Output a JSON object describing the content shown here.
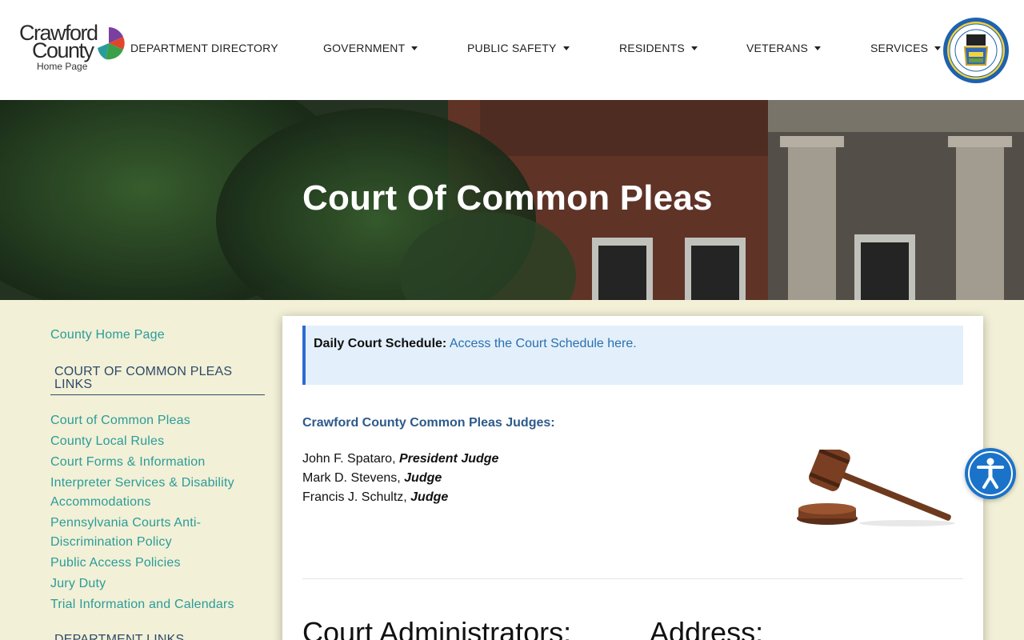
{
  "logo": {
    "line1": "Crawford",
    "line2": "County",
    "sub": "Home Page"
  },
  "nav": [
    {
      "label": "DEPARTMENT DIRECTORY",
      "dropdown": false
    },
    {
      "label": "GOVERNMENT",
      "dropdown": true
    },
    {
      "label": "PUBLIC SAFETY",
      "dropdown": true
    },
    {
      "label": "RESIDENTS",
      "dropdown": true
    },
    {
      "label": "VETERANS",
      "dropdown": true
    },
    {
      "label": "SERVICES",
      "dropdown": true
    }
  ],
  "hero": {
    "title": "Court Of Common Pleas"
  },
  "sidebar": {
    "home_link": "County Home Page",
    "section1_heading_line1": "COURT OF COMMON PLEAS",
    "section1_heading_line2": "LINKS",
    "links": [
      "Court of Common Pleas",
      "County Local Rules",
      "Court Forms & Information",
      "Interpreter Services & Disability",
      "Accommodations",
      "Pennsylvania Courts Anti-",
      "Discrimination Policy",
      "Public Access Policies",
      "Jury Duty",
      "Trial Information and Calendars"
    ],
    "section2_heading": "DEPARTMENT LINKS"
  },
  "content": {
    "alert_label": "Daily Court Schedule:",
    "alert_link": "Access the Court Schedule here.",
    "judges_heading": "Crawford County Common Pleas Judges:",
    "judges": [
      {
        "name": "John F. Spataro, ",
        "title": "President Judge"
      },
      {
        "name": "Mark D. Stevens, ",
        "title": "Judge"
      },
      {
        "name": "Francis J. Schultz, ",
        "title": "Judge"
      }
    ],
    "heading_left": "Court Administrators:",
    "heading_right": "Address:"
  },
  "colors": {
    "teal_link": "#2a9c9a",
    "navy": "#2d4a6b",
    "cream": "#f2f0d6",
    "alert_bg": "#e3f0fb",
    "accessibility_blue": "#1b73c9"
  },
  "icons": {
    "gavel": "gavel-image",
    "accessibility": "accessibility-icon",
    "seal": "county-seal"
  }
}
